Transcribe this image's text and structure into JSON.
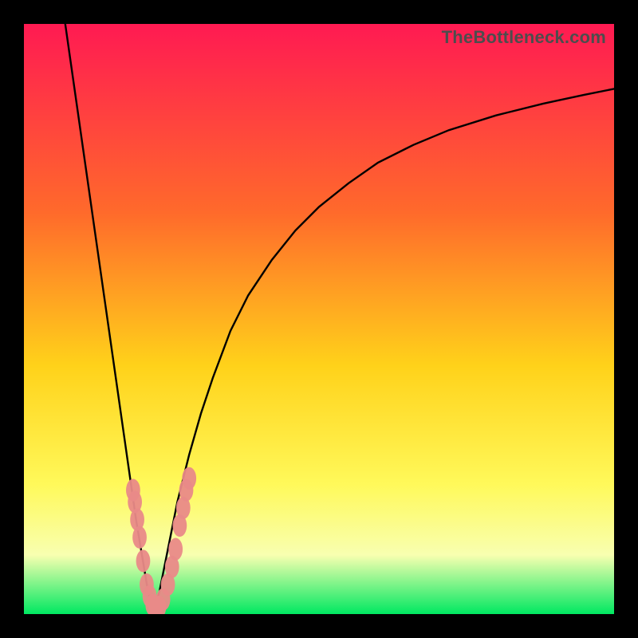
{
  "watermark": "TheBottleneck.com",
  "colors": {
    "gradient_top": "#ff1a52",
    "gradient_mid_upper": "#ff6a2b",
    "gradient_mid": "#ffd21a",
    "gradient_mid_lower": "#fff95a",
    "gradient_pale": "#f8ffb0",
    "gradient_bottom": "#00e861",
    "curve": "#000000",
    "marker_fill": "#e98a88",
    "marker_stroke": "#c86b69",
    "frame": "#000000"
  },
  "chart_data": {
    "type": "line",
    "title": "",
    "xlabel": "",
    "ylabel": "",
    "xlim": [
      0,
      100
    ],
    "ylim": [
      0,
      100
    ],
    "x_optimum": 22,
    "series": [
      {
        "name": "left-branch",
        "x": [
          7,
          8,
          9,
          10,
          11,
          12,
          13,
          14,
          15,
          16,
          17,
          18,
          19,
          20,
          21,
          22
        ],
        "y": [
          100,
          93,
          86,
          79,
          72,
          65,
          58,
          51,
          44,
          37,
          30,
          23,
          16,
          10,
          4,
          0
        ]
      },
      {
        "name": "right-branch",
        "x": [
          22,
          23,
          24,
          25,
          26,
          27,
          28,
          30,
          32,
          35,
          38,
          42,
          46,
          50,
          55,
          60,
          66,
          72,
          80,
          88,
          95,
          100
        ],
        "y": [
          0,
          4,
          9,
          14,
          19,
          23,
          27,
          34,
          40,
          48,
          54,
          60,
          65,
          69,
          73,
          76.5,
          79.5,
          82,
          84.5,
          86.5,
          88,
          89
        ]
      }
    ],
    "markers": {
      "name": "sample-points",
      "points": [
        {
          "x": 18.5,
          "y": 21
        },
        {
          "x": 18.8,
          "y": 19
        },
        {
          "x": 19.2,
          "y": 16
        },
        {
          "x": 19.6,
          "y": 13
        },
        {
          "x": 20.2,
          "y": 9
        },
        {
          "x": 20.8,
          "y": 5
        },
        {
          "x": 21.3,
          "y": 3
        },
        {
          "x": 21.8,
          "y": 1.5
        },
        {
          "x": 22.3,
          "y": 0.7
        },
        {
          "x": 22.9,
          "y": 1.2
        },
        {
          "x": 23.6,
          "y": 2.5
        },
        {
          "x": 24.4,
          "y": 5
        },
        {
          "x": 25.1,
          "y": 8
        },
        {
          "x": 25.7,
          "y": 11
        },
        {
          "x": 26.4,
          "y": 15
        },
        {
          "x": 27.0,
          "y": 18
        },
        {
          "x": 27.5,
          "y": 21
        },
        {
          "x": 28.0,
          "y": 23
        }
      ],
      "rx": 1.2,
      "ry": 1.9
    }
  }
}
